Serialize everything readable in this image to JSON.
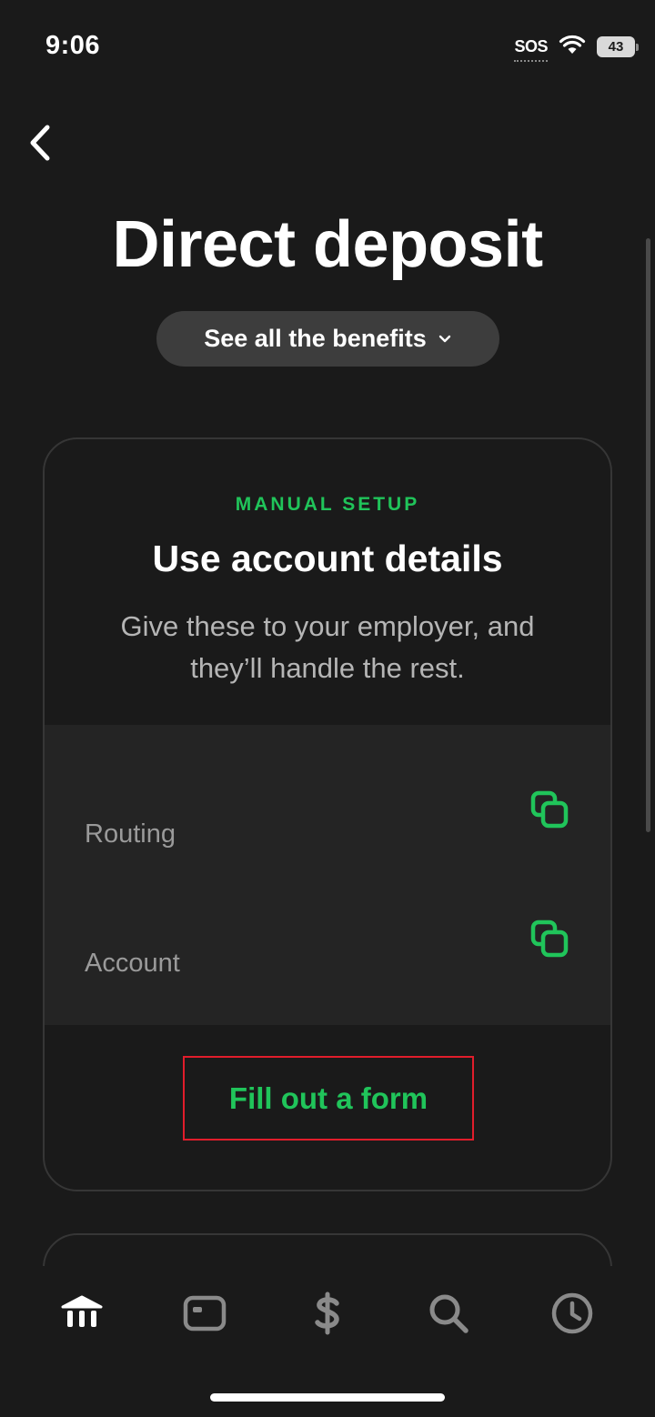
{
  "status_bar": {
    "time": "9:06",
    "sos": "SOS",
    "battery": "43"
  },
  "header": {
    "title": "Direct deposit",
    "benefits_button": "See all the benefits"
  },
  "manual_setup_card": {
    "eyebrow": "MANUAL SETUP",
    "heading": "Use account details",
    "description": "Give these to your employer, and they’ll handle the rest.",
    "rows": [
      {
        "label": "Routing"
      },
      {
        "label": "Account"
      }
    ],
    "form_button": "Fill out a form"
  },
  "tab_bar": {
    "items": [
      {
        "icon": "bank-icon",
        "active": true
      },
      {
        "icon": "card-icon",
        "active": false
      },
      {
        "icon": "dollar-icon",
        "active": false
      },
      {
        "icon": "search-icon",
        "active": false
      },
      {
        "icon": "clock-icon",
        "active": false
      }
    ]
  },
  "colors": {
    "background": "#1a1a1a",
    "accent_green": "#20c45a",
    "highlight_red": "#e11d2b",
    "pill": "#3d3d3d"
  }
}
